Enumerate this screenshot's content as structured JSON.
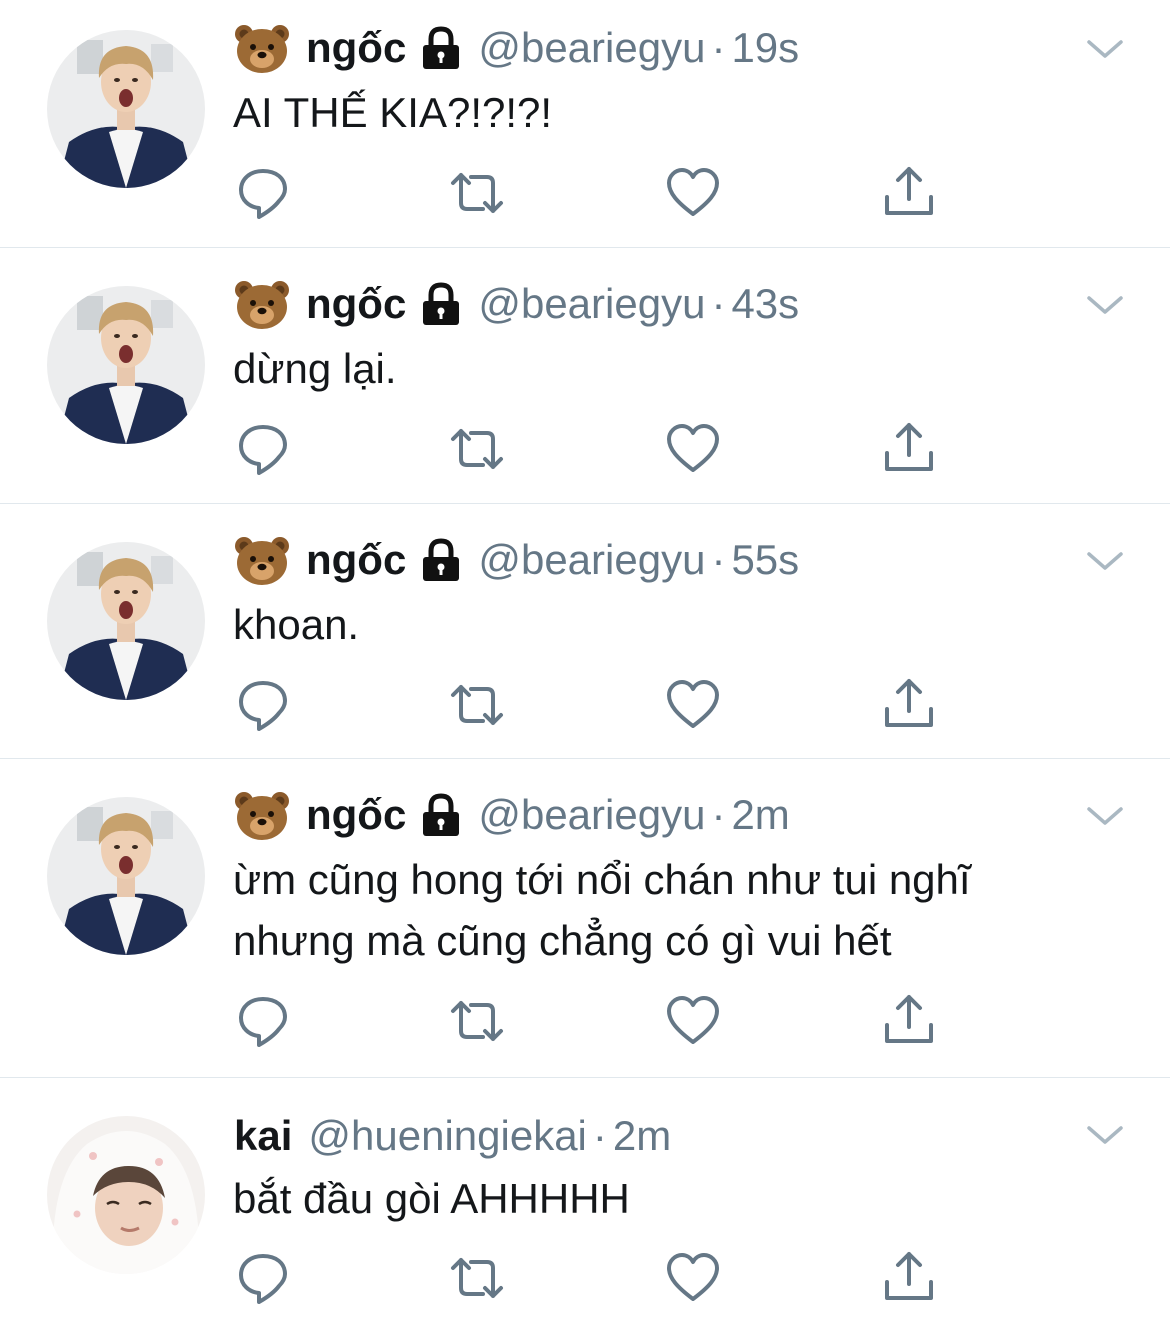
{
  "tweets": [
    {
      "name": "ngốc",
      "handle": "@beariegyu",
      "separator": "·",
      "time": "19s",
      "text": [
        "AI THẾ KIA?!?!?!"
      ],
      "bear_emoji": true,
      "locked": true,
      "avatar": "avatar-shocked-boy"
    },
    {
      "name": "ngốc",
      "handle": "@beariegyu",
      "separator": "·",
      "time": "43s",
      "text": [
        "dừng lại."
      ],
      "bear_emoji": true,
      "locked": true,
      "avatar": "avatar-shocked-boy"
    },
    {
      "name": "ngốc",
      "handle": "@beariegyu",
      "separator": "·",
      "time": "55s",
      "text": [
        "khoan."
      ],
      "bear_emoji": true,
      "locked": true,
      "avatar": "avatar-shocked-boy"
    },
    {
      "name": "ngốc",
      "handle": "@beariegyu",
      "separator": "·",
      "time": "2m",
      "text": [
        "ừm cũng hong tới nổi chán như tui nghĩ",
        "nhưng mà cũng chẳng có gì vui hết"
      ],
      "bear_emoji": true,
      "locked": true,
      "avatar": "avatar-shocked-boy"
    },
    {
      "name": "kai",
      "handle": "@hueningiekai",
      "separator": "·",
      "time": "2m",
      "text": [
        "bắt đầu gòi AHHHHH"
      ],
      "bear_emoji": false,
      "locked": false,
      "avatar": "avatar-white-hood"
    }
  ],
  "icons": {
    "reply": "reply-icon",
    "retweet": "retweet-icon",
    "like": "heart-icon",
    "share": "share-icon",
    "more": "chevron-down-icon",
    "lock": "lock-icon",
    "bear": "bear-emoji-icon"
  },
  "colors": {
    "text": "#14171a",
    "secondary": "#657786",
    "divider": "#e1e8ed",
    "chevron": "#aab8c2"
  }
}
